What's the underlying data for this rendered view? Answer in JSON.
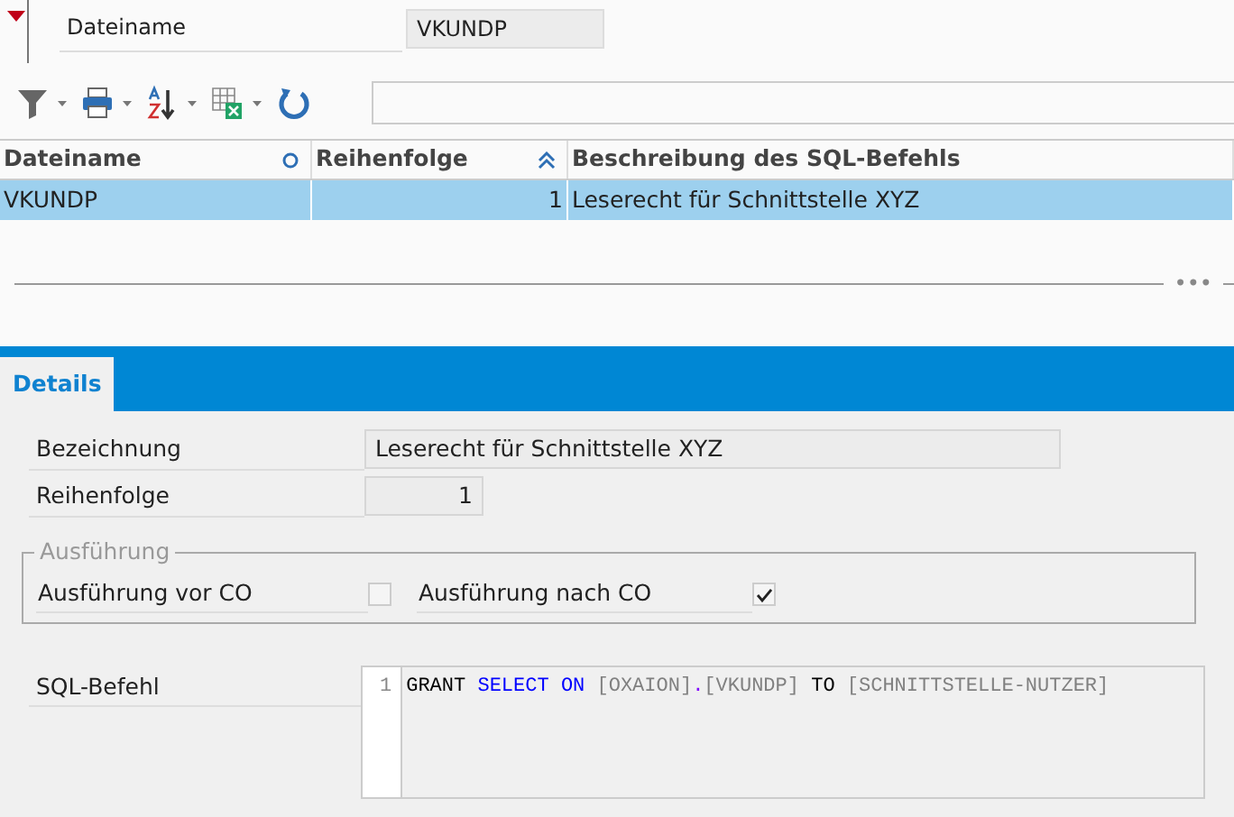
{
  "header": {
    "label": "Dateiname",
    "value": "VKUNDP"
  },
  "table": {
    "columns": [
      {
        "label": "Dateiname",
        "kind": "sortable"
      },
      {
        "label": "Reihenfolge",
        "kind": "ascending"
      },
      {
        "label": "Beschreibung des SQL-Befehls",
        "kind": "plain"
      }
    ],
    "rows": [
      {
        "selected": true,
        "cells": [
          "VKUNDP",
          "1",
          "Leserecht für Schnittstelle XYZ"
        ]
      }
    ]
  },
  "splitter": {
    "handle": "•••"
  },
  "tabs": [
    {
      "label": "Details",
      "selected": true
    }
  ],
  "details": {
    "fields": [
      {
        "label": "Bezeichnung",
        "value": "Leserecht für Schnittstelle XYZ",
        "kind": "text"
      },
      {
        "label": "Reihenfolge",
        "value": "1",
        "kind": "number"
      }
    ],
    "group": {
      "title": "Ausführung",
      "options": [
        {
          "label": "Ausführung vor CO",
          "checked": false
        },
        {
          "label": "Ausführung nach CO",
          "checked": true
        }
      ]
    },
    "sql": {
      "label": "SQL-Befehl",
      "line_number": "1",
      "tokens": [
        {
          "text": "GRANT",
          "kind": "plain"
        },
        {
          "text": "SELECT",
          "kind": "keyword"
        },
        {
          "text": "ON",
          "kind": "keyword"
        },
        {
          "text": "[OXAION]",
          "kind": "identifier"
        },
        {
          "text": ".",
          "kind": "operator"
        },
        {
          "text": "[VKUNDP]",
          "kind": "identifier"
        },
        {
          "text": "TO",
          "kind": "plain"
        },
        {
          "text": "[SCHNITTSTELLE-NUTZER]",
          "kind": "identifier"
        }
      ]
    }
  }
}
